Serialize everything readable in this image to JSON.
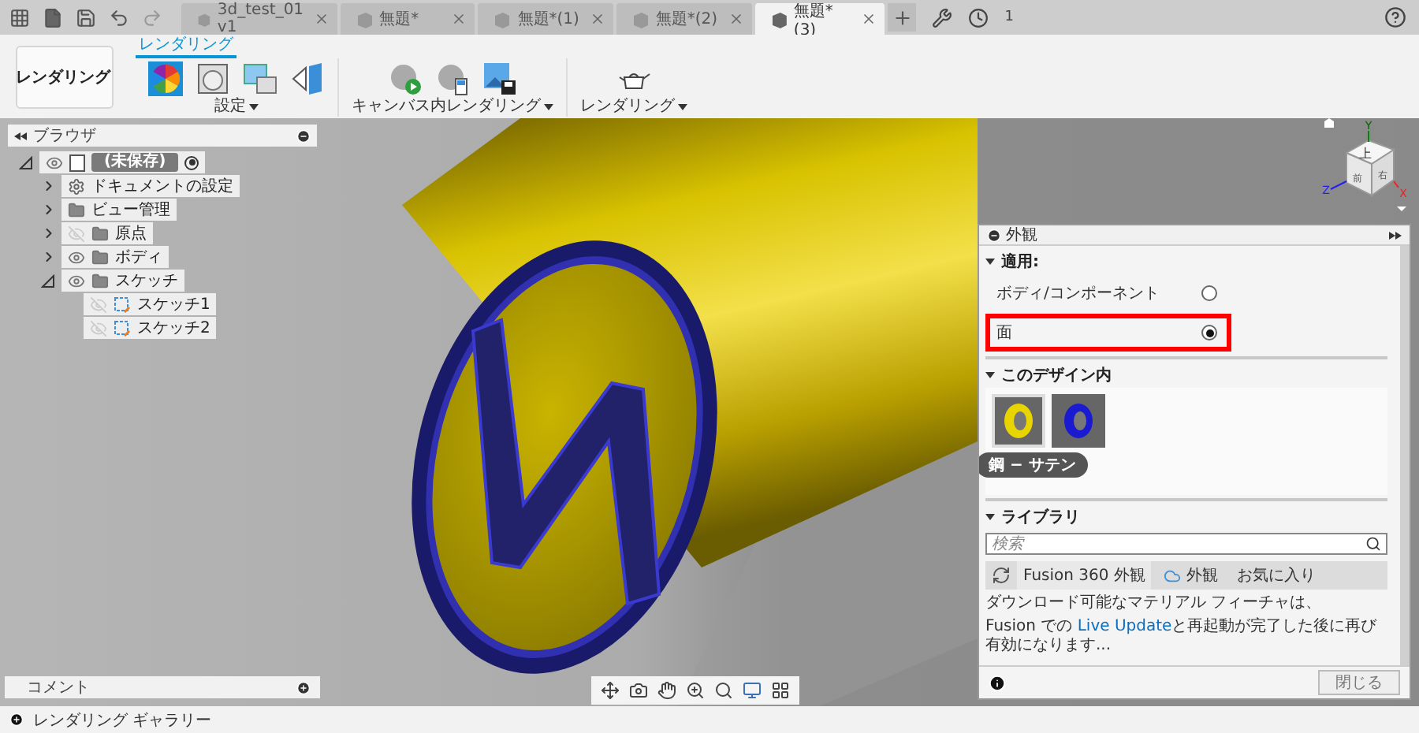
{
  "title_bar": {
    "tabs": [
      {
        "label": "3d_test_01 v1",
        "selected": false
      },
      {
        "label": "無題*",
        "selected": false
      },
      {
        "label": "無題*(1)",
        "selected": false
      },
      {
        "label": "無題*(2)",
        "selected": false
      },
      {
        "label": "無題*(3)",
        "selected": true
      }
    ],
    "job_count": "1"
  },
  "ribbon": {
    "workspace": "レンダリング",
    "tab": {
      "label": "レンダリング",
      "selected": true
    },
    "groups": [
      {
        "label": "設定",
        "tools": [
          {
            "kind": "appearance"
          },
          {
            "kind": "scene"
          },
          {
            "kind": "texture"
          },
          {
            "kind": "decal"
          }
        ]
      },
      {
        "label": "キャンバス内レンダリング",
        "tools": [
          {
            "kind": "render-start"
          },
          {
            "kind": "render-settings"
          },
          {
            "kind": "capture"
          }
        ]
      },
      {
        "label": "レンダリング",
        "tools": [
          {
            "kind": "teapot"
          }
        ]
      }
    ]
  },
  "browser": {
    "title": "ブラウザ",
    "root": {
      "label": "(未保存)",
      "kind": "component",
      "expanded": true,
      "visible": true,
      "active": true,
      "children": [
        {
          "label": "ドキュメントの設定",
          "kind": "settings",
          "expanded": false
        },
        {
          "label": "ビュー管理",
          "kind": "folder",
          "expanded": false
        },
        {
          "label": "原点",
          "kind": "folder",
          "expanded": false,
          "visible": false
        },
        {
          "label": "ボディ",
          "kind": "folder",
          "expanded": false,
          "visible": true
        },
        {
          "label": "スケッチ",
          "kind": "folder",
          "expanded": true,
          "visible": true,
          "children": [
            {
              "label": "スケッチ1",
              "kind": "sketch",
              "visible": false
            },
            {
              "label": "スケッチ2",
              "kind": "sketch",
              "visible": false
            }
          ]
        }
      ]
    }
  },
  "view_cube": {
    "face_top": "上",
    "face_front": "前",
    "face_right": "右",
    "axes": [
      "Y",
      "X",
      "Z"
    ]
  },
  "appearance_panel": {
    "title": "外観",
    "apply": {
      "heading": "適用:",
      "options": [
        {
          "label": "ボディ/コンポーネント",
          "selected": false,
          "highlighted": false
        },
        {
          "label": "面",
          "selected": true,
          "highlighted": true
        }
      ]
    },
    "in_design": {
      "heading": "このデザイン内",
      "swatches": [
        {
          "color": "#e8d400",
          "selected": true
        },
        {
          "color": "#1a1ad0",
          "selected": false
        }
      ],
      "tooltip": "鋼 − サテン"
    },
    "library": {
      "heading": "ライブラリ",
      "search_placeholder": "検索",
      "tabs": [
        {
          "label": "Fusion 360 外観",
          "kind": "plain",
          "selected": true
        },
        {
          "label": "外観",
          "kind": "cloud",
          "selected": false
        },
        {
          "label": "お気に入り",
          "kind": "plain",
          "selected": false
        }
      ],
      "message": "ダウンロード可能なマテリアル フィーチャは、",
      "notice": {
        "before": "Fusion での ",
        "link": "Live Update",
        "after": "と再起動が完了した後に再び有効になります..."
      }
    },
    "close_button": "閉じる"
  },
  "comments": {
    "title": "コメント"
  },
  "gallery": {
    "title": "レンダリング ギャラリー"
  }
}
